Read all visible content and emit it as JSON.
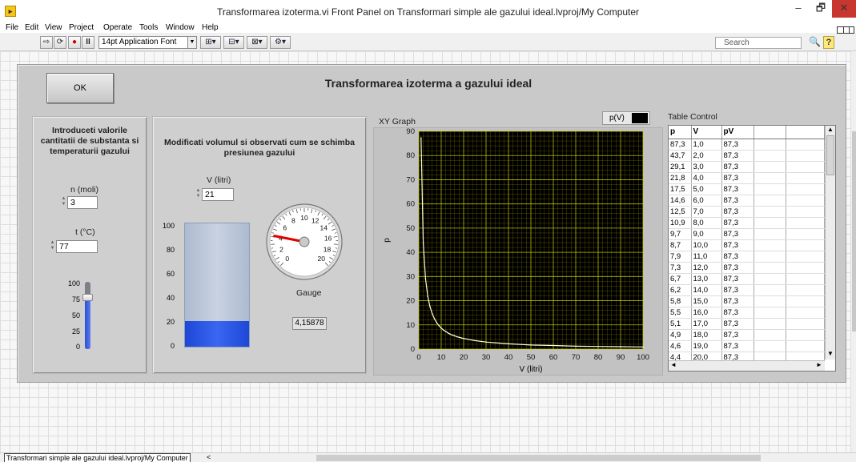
{
  "window": {
    "title": "Transformarea izoterma.vi Front Panel on Transformari simple ale gazului ideal.lvproj/My Computer",
    "app_icon": "labview-icon",
    "controls": {
      "minimize": "–",
      "maximize": "🗗",
      "close": "✕"
    }
  },
  "menu": [
    "File",
    "Edit",
    "View",
    "Project",
    "Operate",
    "Tools",
    "Window",
    "Help"
  ],
  "toolbar": {
    "font": "14pt Application Font",
    "search_placeholder": "Search",
    "icons": [
      "run-arrow-icon",
      "run-continuously-icon",
      "abort-icon",
      "pause-icon",
      "align-icon",
      "distribute-icon",
      "resize-icon",
      "reorder-icon",
      "cleanup-icon",
      "search-icon",
      "help-icon",
      "connector-pane-icon"
    ]
  },
  "panel": {
    "ok_label": "OK",
    "title": "Transformarea izoterma a gazului ideal",
    "left_box_title": "Introduceti valorile cantitatii de substanta si temperaturii gazului",
    "mid_box_title": "Modificati volumul si observati cum se schimba presiunea gazului",
    "n_label": "n (moli)",
    "n_value": "3",
    "t_label": "t (°C)",
    "t_value": "77",
    "slider_ticks": [
      "100",
      "75",
      "50",
      "25",
      "0"
    ],
    "slider_level": 0.77,
    "v_label": "V (litri)",
    "v_value": "21",
    "tank_ticks": [
      "100",
      "80",
      "60",
      "40",
      "20",
      "0"
    ],
    "tank_level": 0.21,
    "gauge_label": "Gauge",
    "gauge_ticks": [
      "0",
      "2",
      "4",
      "6",
      "8",
      "10",
      "12",
      "14",
      "16",
      "18",
      "20"
    ],
    "gauge_value": 4.15878,
    "gauge_display": "4,15878",
    "graph_label": "XY Graph",
    "graph_legend": "p(V)",
    "table_label": "Table Control"
  },
  "chart_data": {
    "type": "line",
    "xlabel": "V (litri)",
    "ylabel": "p",
    "xlim": [
      0,
      100
    ],
    "ylim": [
      0,
      90
    ],
    "x_ticks": [
      0,
      10,
      20,
      30,
      40,
      50,
      60,
      70,
      80,
      90,
      100
    ],
    "y_ticks": [
      0,
      10,
      20,
      30,
      40,
      50,
      60,
      70,
      80,
      90
    ],
    "grid": true,
    "series": [
      {
        "name": "p(V)",
        "x": [
          1,
          2,
          3,
          4,
          5,
          6,
          7,
          8,
          9,
          10,
          11,
          12,
          13,
          14,
          15,
          16,
          17,
          18,
          19,
          20,
          25,
          30,
          40,
          50,
          60,
          70,
          80,
          90,
          100
        ],
        "y": [
          87.3,
          43.7,
          29.1,
          21.8,
          17.5,
          14.6,
          12.5,
          10.9,
          9.7,
          8.7,
          7.9,
          7.3,
          6.7,
          6.2,
          5.8,
          5.5,
          5.1,
          4.9,
          4.6,
          4.4,
          3.5,
          2.9,
          2.2,
          1.7,
          1.5,
          1.2,
          1.1,
          1.0,
          0.9
        ]
      }
    ]
  },
  "table": {
    "headers": [
      "p",
      "V",
      "pV"
    ],
    "rows": [
      [
        "87,3",
        "1,0",
        "87,3"
      ],
      [
        "43,7",
        "2,0",
        "87,3"
      ],
      [
        "29,1",
        "3,0",
        "87,3"
      ],
      [
        "21,8",
        "4,0",
        "87,3"
      ],
      [
        "17,5",
        "5,0",
        "87,3"
      ],
      [
        "14,6",
        "6,0",
        "87,3"
      ],
      [
        "12,5",
        "7,0",
        "87,3"
      ],
      [
        "10,9",
        "8,0",
        "87,3"
      ],
      [
        "9,7",
        "9,0",
        "87,3"
      ],
      [
        "8,7",
        "10,0",
        "87,3"
      ],
      [
        "7,9",
        "11,0",
        "87,3"
      ],
      [
        "7,3",
        "12,0",
        "87,3"
      ],
      [
        "6,7",
        "13,0",
        "87,3"
      ],
      [
        "6,2",
        "14,0",
        "87,3"
      ],
      [
        "5,8",
        "15,0",
        "87,3"
      ],
      [
        "5,5",
        "16,0",
        "87,3"
      ],
      [
        "5,1",
        "17,0",
        "87,3"
      ],
      [
        "4,9",
        "18,0",
        "87,3"
      ],
      [
        "4,6",
        "19,0",
        "87,3"
      ],
      [
        "4,4",
        "20,0",
        "87,3"
      ]
    ]
  },
  "statusbar": {
    "path": "Transformari simple ale gazului ideal.lvproj/My Computer",
    "arrow": "<"
  },
  "colors": {
    "plot_bg": "#000000",
    "plot_grid": "#cccc00",
    "plot_line": "#ffffcc",
    "slider_fill": "#2c4fd0",
    "tank_fill": "#1e47d6",
    "needle": "#e00000"
  }
}
